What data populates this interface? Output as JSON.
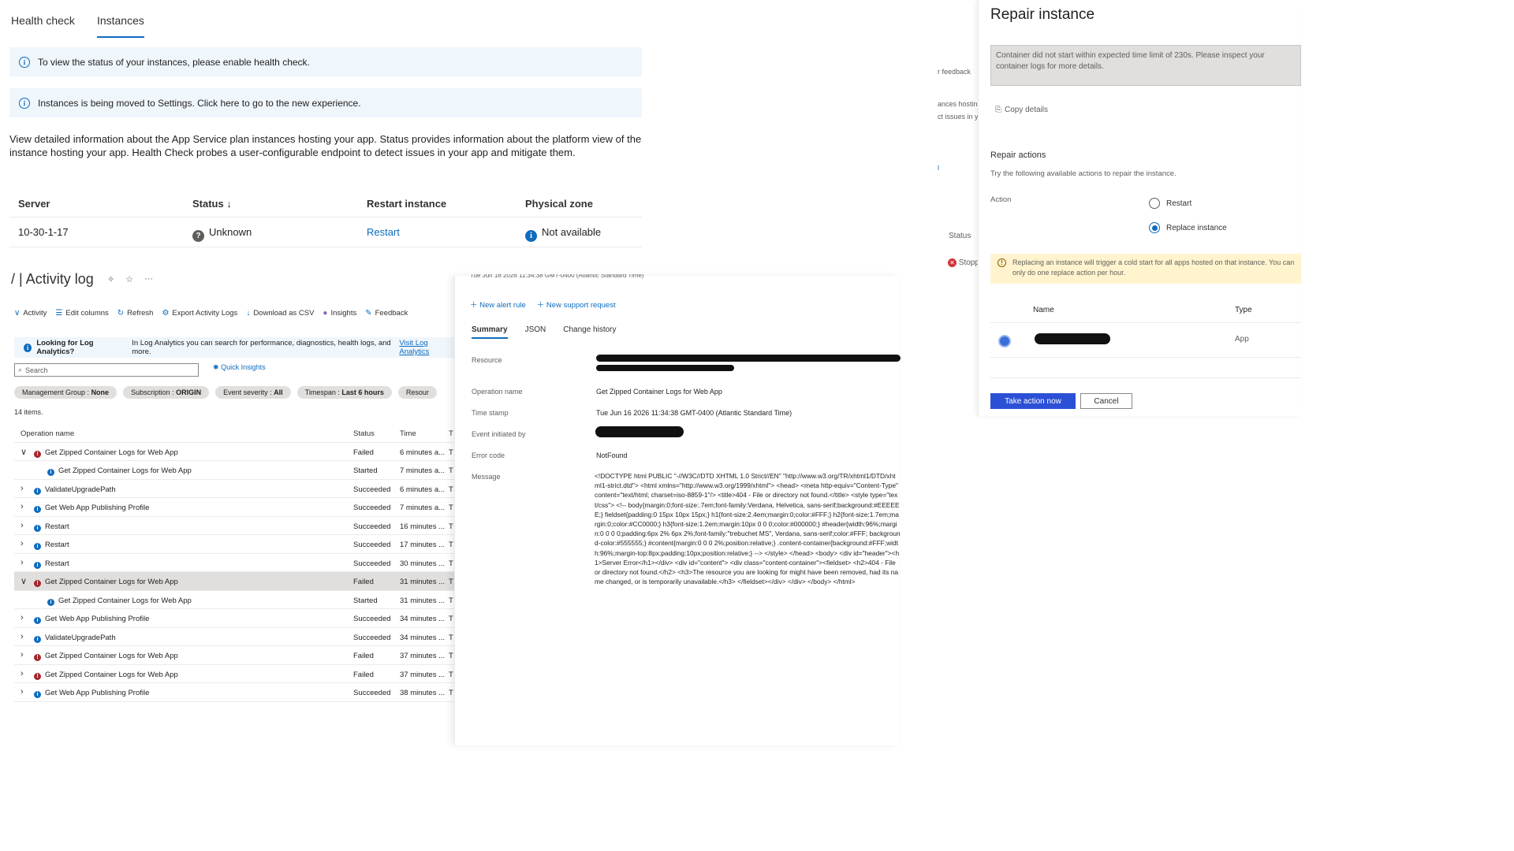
{
  "instances": {
    "tabs": [
      "Health check",
      "Instances"
    ],
    "banner_health": "To view the status of your instances, please enable health check.",
    "banner_moved": "Instances is being moved to Settings. Click here to go to the new experience.",
    "description": "View detailed information about the App Service plan instances hosting your app. Status provides information about the platform view of the instance hosting your app. Health Check probes a user-configurable endpoint to detect issues in your app and mitigate them.",
    "columns": [
      "Server",
      "Status ↓",
      "Restart instance",
      "Physical zone"
    ],
    "row": {
      "server": "10-30-1-17",
      "status": "Unknown",
      "restart": "Restart",
      "zone": "Not available"
    }
  },
  "activity_log": {
    "title": "/ | Activity log",
    "title_icons": [
      "✧",
      "☆",
      "···"
    ],
    "toolbar": [
      "Activity",
      "Edit columns",
      "Refresh",
      "Export Activity Logs",
      "Download as CSV",
      "Insights",
      "Feedback"
    ],
    "banner_bold": "Looking for Log Analytics?",
    "banner_text": "In Log Analytics you can search for performance, diagnostics, health logs, and more.",
    "banner_link": "Visit Log Analytics",
    "search_placeholder": "Search",
    "quick_insights": "Quick Insights",
    "filters": [
      {
        "label": "Management Group : ",
        "value": "None"
      },
      {
        "label": "Subscription : ",
        "value": "ORIGIN"
      },
      {
        "label": "Event severity : ",
        "value": "All"
      },
      {
        "label": "Timespan : ",
        "value": "Last 6 hours"
      },
      {
        "label": "Resour",
        "value": ""
      }
    ],
    "count": "14 items.",
    "columns": [
      "Operation name",
      "Status",
      "Time",
      "T"
    ],
    "rows": [
      {
        "chevron": "∨",
        "indent": 0,
        "icon": "failed",
        "name": "Get Zipped Container Logs for Web App",
        "status": "Failed",
        "time": "6 minutes a...",
        "t": "T"
      },
      {
        "chevron": "",
        "indent": 1,
        "icon": "info",
        "name": "Get Zipped Container Logs for Web App",
        "status": "Started",
        "time": "7 minutes a...",
        "t": "T"
      },
      {
        "chevron": "›",
        "indent": 0,
        "icon": "info",
        "name": "ValidateUpgradePath",
        "status": "Succeeded",
        "time": "6 minutes a...",
        "t": "T"
      },
      {
        "chevron": "›",
        "indent": 0,
        "icon": "info",
        "name": "Get Web App Publishing Profile",
        "status": "Succeeded",
        "time": "7 minutes a...",
        "t": "T"
      },
      {
        "chevron": "›",
        "indent": 0,
        "icon": "info",
        "name": "Restart",
        "status": "Succeeded",
        "time": "16 minutes ...",
        "t": "T"
      },
      {
        "chevron": "›",
        "indent": 0,
        "icon": "info",
        "name": "Restart",
        "status": "Succeeded",
        "time": "17 minutes ...",
        "t": "T"
      },
      {
        "chevron": "›",
        "indent": 0,
        "icon": "info",
        "name": "Restart",
        "status": "Succeeded",
        "time": "30 minutes ...",
        "t": "T"
      },
      {
        "chevron": "∨",
        "indent": 0,
        "icon": "failed",
        "name": "Get Zipped Container Logs for Web App",
        "status": "Failed",
        "time": "31 minutes ...",
        "t": "T",
        "selected": true
      },
      {
        "chevron": "",
        "indent": 1,
        "icon": "info",
        "name": "Get Zipped Container Logs for Web App",
        "status": "Started",
        "time": "31 minutes ...",
        "t": "T"
      },
      {
        "chevron": "›",
        "indent": 0,
        "icon": "info",
        "name": "Get Web App Publishing Profile",
        "status": "Succeeded",
        "time": "34 minutes ...",
        "t": "T"
      },
      {
        "chevron": "›",
        "indent": 0,
        "icon": "info",
        "name": "ValidateUpgradePath",
        "status": "Succeeded",
        "time": "34 minutes ...",
        "t": "T"
      },
      {
        "chevron": "›",
        "indent": 0,
        "icon": "failed",
        "name": "Get Zipped Container Logs for Web App",
        "status": "Failed",
        "time": "37 minutes ...",
        "t": "T"
      },
      {
        "chevron": "›",
        "indent": 0,
        "icon": "failed",
        "name": "Get Zipped Container Logs for Web App",
        "status": "Failed",
        "time": "37 minutes ...",
        "t": "T"
      },
      {
        "chevron": "›",
        "indent": 0,
        "icon": "info",
        "name": "Get Web App Publishing Profile",
        "status": "Succeeded",
        "time": "38 minutes ...",
        "t": "T"
      }
    ]
  },
  "detail": {
    "header_cut": "Tue Jun 16 2026 11:34:38 GMT-0400 (Atlantic Standard Time)",
    "actions": [
      "New alert rule",
      "New support request"
    ],
    "tabs": [
      "Summary",
      "JSON",
      "Change history"
    ],
    "fields": {
      "resource_label": "Resource",
      "operation_label": "Operation name",
      "operation_value": "Get Zipped Container Logs for Web App",
      "timestamp_label": "Time stamp",
      "timestamp_value": "Tue Jun 16 2026 11:34:38 GMT-0400 (Atlantic Standard Time)",
      "initiated_label": "Event initiated by",
      "error_label": "Error code",
      "error_value": "NotFound",
      "message_label": "Message",
      "message_value": "<!DOCTYPE html PUBLIC \"-//W3C//DTD XHTML 1.0 Strict//EN\" \"http://www.w3.org/TR/xhtml1/DTD/xhtml1-strict.dtd\"> <html xmlns=\"http://www.w3.org/1999/xhtml\"> <head> <meta http-equiv=\"Content-Type\" content=\"text/html; charset=iso-8859-1\"/> <title>404 - File or directory not found.</title> <style type=\"text/css\"> <!-- body{margin:0;font-size:.7em;font-family:Verdana, Helvetica, sans-serif;background:#EEEEEE;} fieldset{padding:0 15px 10px 15px;} h1{font-size:2.4em;margin:0;color:#FFF;} h2{font-size:1.7em;margin:0;color:#CC0000;} h3{font-size:1.2em;margin:10px 0 0 0;color:#000000;} #header{width:96%;margin:0 0 0 0;padding:6px 2% 6px 2%;font-family:\"trebuchet MS\", Verdana, sans-serif;color:#FFF; background-color:#555555;} #content{margin:0 0 0 2%;position:relative;} .content-container{background:#FFF;width:96%;margin-top:8px;padding:10px;position:relative;} --> </style> </head> <body> <div id=\"header\"><h1>Server Error</h1></div> <div id=\"content\"> <div class=\"content-container\"><fieldset> <h2>404 - File or directory not found.</h2> <h3>The resource you are looking for might have been removed, had its name changed, or is temporarily unavailable.</h3> </fieldset></div> </div> </body> </html>"
    }
  },
  "background_panel": {
    "feedback": "r feedback",
    "text1": "ances hostin",
    "text2": "ct issues in y",
    "link": "l",
    "status_label": "Status",
    "status_value": "Stopp"
  },
  "repair": {
    "title": "Repair instance",
    "error": "Container did not start within expected time limit of 230s. Please inspect your container logs for more details.",
    "copy": "Copy details",
    "section": "Repair actions",
    "sub": "Try the following available actions to repair the instance.",
    "action_label": "Action",
    "options": [
      "Restart",
      "Replace instance"
    ],
    "selected_option": 1,
    "warning": "Replacing an instance will trigger a cold start for all apps hosted on that instance. You can only do one replace action per hour.",
    "columns": [
      "Name",
      "Type"
    ],
    "row_type": "App",
    "primary_button": "Take action now",
    "cancel_button": "Cancel"
  }
}
